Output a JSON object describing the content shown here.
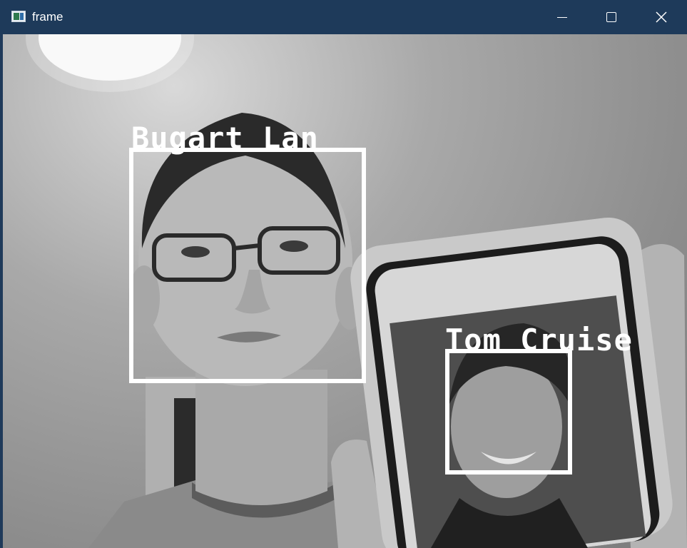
{
  "window": {
    "title": "frame",
    "icons": [
      "app-icon",
      "minimize-icon",
      "maximize-icon",
      "close-icon"
    ]
  },
  "frame": {
    "detections": [
      {
        "label": "Bugart Lan"
      },
      {
        "label": "Tom Cruise"
      }
    ],
    "colors": {
      "box": "#ffffff",
      "label": "#ffffff",
      "titlebar": "#1e3a5a"
    }
  }
}
